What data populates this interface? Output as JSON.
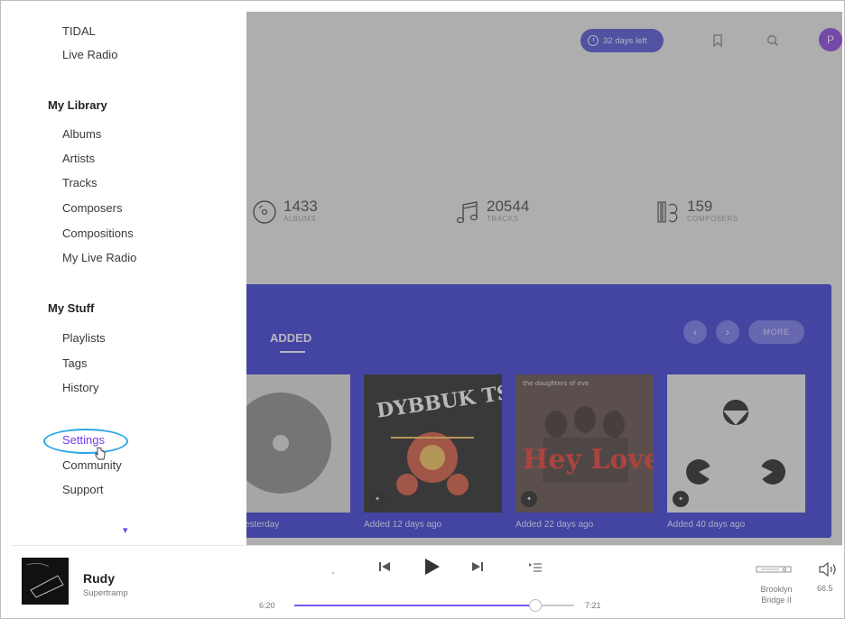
{
  "sidebar": {
    "top_items": [
      "TIDAL",
      "Live Radio"
    ],
    "library_heading": "My Library",
    "library_items": [
      "Albums",
      "Artists",
      "Tracks",
      "Composers",
      "Compositions",
      "My Live Radio"
    ],
    "stuff_heading": "My Stuff",
    "stuff_items": [
      "Playlists",
      "Tags",
      "History"
    ],
    "bottom_items": [
      "Settings",
      "Community",
      "Support"
    ],
    "highlighted_item": "Settings"
  },
  "header": {
    "trial_label": "32 days left",
    "avatar_initial": "P"
  },
  "stats": [
    {
      "value": "1433",
      "label": "ALBUMS"
    },
    {
      "value": "20544",
      "label": "TRACKS"
    },
    {
      "value": "159",
      "label": "COMPOSERS"
    }
  ],
  "recent": {
    "tab_label": "ADDED",
    "more_label": "MORE",
    "albums": [
      {
        "caption": "esterday",
        "artist_line": "",
        "title_line": ""
      },
      {
        "caption": "Added 12 days ago",
        "artist_line": "",
        "title_line": "DYBBUK TSE!"
      },
      {
        "caption": "Added 22 days ago",
        "artist_line": "the daughters of eve",
        "title_line": "Hey Lover"
      },
      {
        "caption": "Added 40 days ago",
        "artist_line": "",
        "title_line": ""
      }
    ]
  },
  "player": {
    "title": "Rudy",
    "artist": "Supertramp",
    "elapsed": "6:20",
    "duration": "7:21",
    "progress_fraction": 0.86,
    "device_name": "Brooklyn Bridge II",
    "volume": "66.5"
  },
  "colors": {
    "accent": "#6f3ff0",
    "panel": "#2727c9",
    "highlight_ring": "#2aa7e6"
  }
}
